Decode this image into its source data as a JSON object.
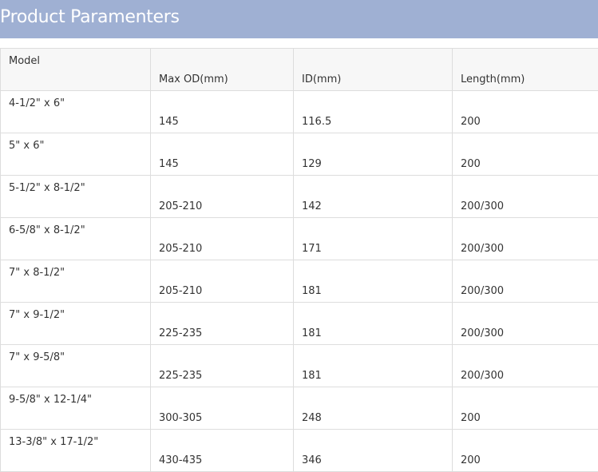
{
  "header": {
    "title": "Product Paramenters"
  },
  "table": {
    "columns": [
      "Model",
      "Max OD(mm)",
      "ID(mm)",
      "Length(mm)"
    ],
    "rows": [
      [
        "4-1/2\" x 6\"",
        "145",
        "116.5",
        "200"
      ],
      [
        "5\" x 6\"",
        "145",
        "129",
        "200"
      ],
      [
        "5-1/2\" x 8-1/2\"",
        "205-210",
        "142",
        "200/300"
      ],
      [
        "6-5/8\" x 8-1/2\"",
        "205-210",
        "171",
        "200/300"
      ],
      [
        "7\" x 8-1/2\"",
        "205-210",
        "181",
        "200/300"
      ],
      [
        "7\" x 9-1/2\"",
        "225-235",
        "181",
        "200/300"
      ],
      [
        "7\" x 9-5/8\"",
        "225-235",
        "181",
        "200/300"
      ],
      [
        "9-5/8\" x 12-1/4\"",
        "300-305",
        "248",
        "200"
      ],
      [
        "13-3/8\" x 17-1/2\"",
        "430-435",
        "346",
        "200"
      ]
    ]
  },
  "colors": {
    "header_bg": "#9fb0d3",
    "header_text": "#ffffff",
    "border": "#dddddd",
    "head_row_bg": "#f7f7f7"
  }
}
